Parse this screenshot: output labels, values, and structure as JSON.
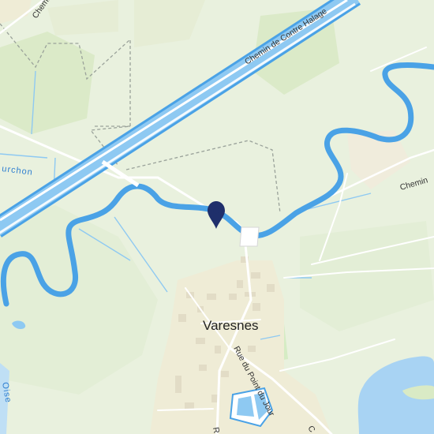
{
  "map": {
    "colors": {
      "land": "#e9f1de",
      "forest": "#d9eac5",
      "town": "#efecd6",
      "water": "#8ec9f2",
      "water_dark": "#4aa2e6",
      "road": "#ffffff",
      "marker": "#1f2f6b"
    },
    "labels": {
      "canal_road": "Chemin de Contre Halage",
      "chemin_top": "Chemin",
      "chemin_right": "Chemin",
      "stream": "urchon",
      "town": "Varesnes",
      "rue_point_du_jour": "Rue du Point du Jour",
      "oise": "Oise",
      "road_bottom_left": "R",
      "road_bottom_right": "C"
    },
    "marker": {
      "icon": "map-pin-icon"
    }
  }
}
